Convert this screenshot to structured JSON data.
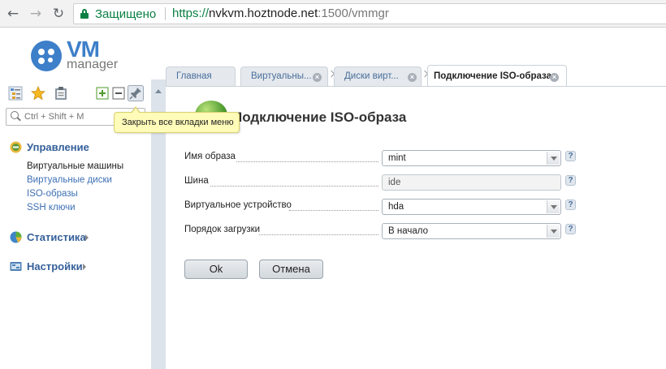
{
  "browser": {
    "secure_label": "Защищено",
    "url_protocol": "https://",
    "url_host": "nvkvm.hoztnode.net",
    "url_path": ":1500/vmmgr"
  },
  "logo": {
    "main": "VM",
    "sub": "manager"
  },
  "sidebar": {
    "search_placeholder": "Ctrl + Shift + M",
    "sections": [
      {
        "label": "Управление",
        "icon": "manage-icon",
        "items": [
          "Виртуальные машины",
          "Виртуальные диски",
          "ISO-образы",
          "SSH ключи"
        ]
      },
      {
        "label": "Статистика",
        "icon": "chart-pie-icon"
      },
      {
        "label": "Настройки",
        "icon": "settings-icon"
      }
    ]
  },
  "tooltip": "Закрыть все вкладки меню",
  "tabs": [
    {
      "label": "Главная"
    },
    {
      "label": "Виртуальны..."
    },
    {
      "label": "Диски вирт..."
    },
    {
      "label": "Подключение ISO-образа"
    }
  ],
  "page": {
    "title": "Подключение ISO-образа",
    "fields": [
      {
        "label": "Имя образа",
        "value": "mint",
        "type": "select"
      },
      {
        "label": "Шина",
        "value": "ide",
        "type": "readonly"
      },
      {
        "label": "Виртуальное устройство",
        "value": "hda",
        "type": "select"
      },
      {
        "label": "Порядок загрузки",
        "value": "В начало",
        "type": "select"
      }
    ],
    "help_glyph": "?",
    "ok_label": "Ok",
    "cancel_label": "Отмена"
  },
  "colors": {
    "accent": "#3d7fc9",
    "secure": "#0b8043",
    "link": "#3d6fb4"
  }
}
